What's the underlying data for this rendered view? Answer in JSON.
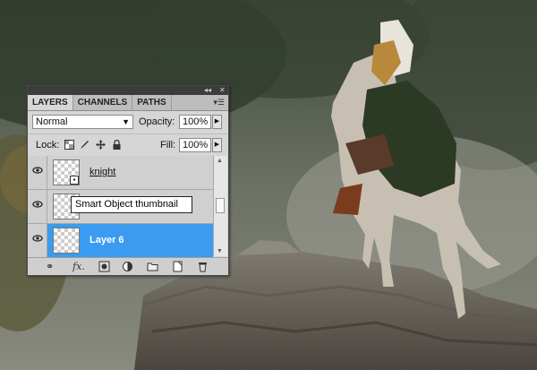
{
  "panel": {
    "tabs": [
      {
        "label": "LAYERS",
        "active": true
      },
      {
        "label": "CHANNELS",
        "active": false
      },
      {
        "label": "PATHS",
        "active": false
      }
    ],
    "window_controls": {
      "collapse": "◂◂",
      "close": "✕"
    },
    "panel_menu_icon": "panel-menu-icon",
    "blend_mode": "Normal",
    "opacity_label": "Opacity:",
    "opacity_value": "100%",
    "lock_label": "Lock:",
    "fill_label": "Fill:",
    "fill_value": "100%",
    "lock_icons": [
      "lock-transparent-pixels-icon",
      "lock-image-pixels-icon",
      "lock-position-icon",
      "lock-all-icon"
    ],
    "layers": [
      {
        "name": "knight",
        "smart_object": true,
        "selected": false
      },
      {
        "name": "",
        "smart_object": true,
        "selected": false
      },
      {
        "name": "Layer 6",
        "smart_object": false,
        "selected": true
      }
    ],
    "bottom_icons": [
      "link-layers-icon",
      "fx-icon",
      "add-mask-icon",
      "adjustment-layer-icon",
      "new-group-icon",
      "new-layer-icon",
      "delete-layer-icon"
    ]
  },
  "tooltip": "Smart Object thumbnail",
  "colors": {
    "selected_layer": "#3a9bf0",
    "panel_bg": "#d6d6d6"
  }
}
